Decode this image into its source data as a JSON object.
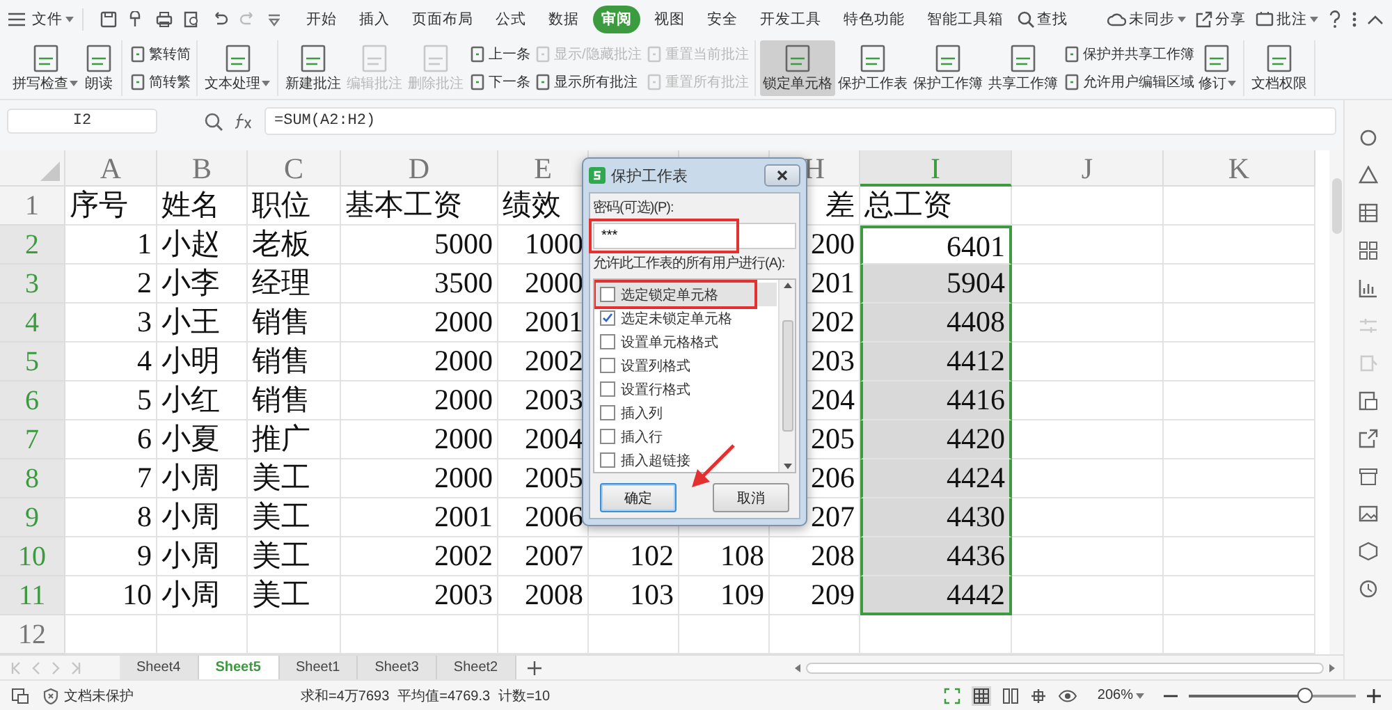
{
  "menu_bar": {
    "file_label": "文件",
    "tabs": [
      {
        "label": "开始",
        "selected": false
      },
      {
        "label": "插入",
        "selected": false
      },
      {
        "label": "页面布局",
        "selected": false
      },
      {
        "label": "公式",
        "selected": false
      },
      {
        "label": "数据",
        "selected": false
      },
      {
        "label": "审阅",
        "selected": true
      },
      {
        "label": "视图",
        "selected": false
      },
      {
        "label": "安全",
        "selected": false
      },
      {
        "label": "开发工具",
        "selected": false
      },
      {
        "label": "特色功能",
        "selected": false
      },
      {
        "label": "智能工具箱",
        "selected": false
      }
    ],
    "search_label": "查找",
    "sync_label": "未同步",
    "share_label": "分享",
    "comment_label": "批注"
  },
  "ribbon": {
    "groups": [
      {
        "items": [
          {
            "kind": "large",
            "label": "拼写检查",
            "dropdown": true,
            "disabled": false,
            "selected": false
          },
          {
            "kind": "large",
            "label": "朗读",
            "dropdown": false,
            "disabled": false,
            "selected": false
          }
        ]
      },
      {
        "items": [
          {
            "kind": "stack",
            "items": [
              {
                "label": "繁转简",
                "disabled": false
              },
              {
                "label": "简转繁",
                "disabled": false
              }
            ]
          }
        ]
      },
      {
        "items": [
          {
            "kind": "large",
            "label": "文本处理",
            "dropdown": true,
            "disabled": false,
            "selected": false
          }
        ]
      },
      {
        "items": [
          {
            "kind": "large",
            "label": "新建批注",
            "dropdown": false,
            "disabled": false,
            "selected": false
          },
          {
            "kind": "large",
            "label": "编辑批注",
            "dropdown": false,
            "disabled": true,
            "selected": false
          },
          {
            "kind": "large",
            "label": "删除批注",
            "dropdown": false,
            "disabled": true,
            "selected": false
          },
          {
            "kind": "stack",
            "items": [
              {
                "label": "上一条",
                "disabled": false
              },
              {
                "label": "下一条",
                "disabled": false
              }
            ]
          },
          {
            "kind": "stack",
            "items": [
              {
                "label": "显示/隐藏批注",
                "disabled": true
              },
              {
                "label": "显示所有批注",
                "disabled": false
              }
            ]
          },
          {
            "kind": "stack",
            "items": [
              {
                "label": "重置当前批注",
                "disabled": true
              },
              {
                "label": "重置所有批注",
                "disabled": true
              }
            ]
          }
        ]
      },
      {
        "items": [
          {
            "kind": "large",
            "label": "锁定单元格",
            "dropdown": false,
            "disabled": false,
            "selected": true
          },
          {
            "kind": "large",
            "label": "保护工作表",
            "dropdown": false,
            "disabled": false,
            "selected": false
          },
          {
            "kind": "large",
            "label": "保护工作簿",
            "dropdown": false,
            "disabled": false,
            "selected": false
          },
          {
            "kind": "large",
            "label": "共享工作簿",
            "dropdown": false,
            "disabled": false,
            "selected": false
          },
          {
            "kind": "stack",
            "items": [
              {
                "label": "保护并共享工作簿",
                "disabled": false
              },
              {
                "label": "允许用户编辑区域",
                "disabled": false
              }
            ]
          },
          {
            "kind": "large",
            "label": "修订",
            "dropdown": true,
            "disabled": false,
            "selected": false
          }
        ]
      },
      {
        "items": [
          {
            "kind": "large",
            "label": "文档权限",
            "dropdown": false,
            "disabled": false,
            "selected": false
          }
        ]
      }
    ]
  },
  "formula_bar": {
    "cell_name": "I2",
    "formula": "=SUM(A2:H2)"
  },
  "sheet": {
    "columns": [
      {
        "label": "A",
        "numeric": true,
        "selected": false
      },
      {
        "label": "B",
        "numeric": false,
        "selected": false
      },
      {
        "label": "C",
        "numeric": false,
        "selected": false
      },
      {
        "label": "D",
        "numeric": true,
        "selected": false
      },
      {
        "label": "E",
        "numeric": true,
        "selected": false
      },
      {
        "numeric": true,
        "selected": false
      },
      {
        "numeric": true,
        "selected": false
      },
      {
        "label": "H",
        "numeric": true,
        "selected": false
      },
      {
        "label": "I",
        "numeric": true,
        "selected": true
      },
      {
        "label": "J",
        "selected": false
      },
      {
        "label": "K",
        "selected": false
      }
    ],
    "rows": [
      {
        "label": "1",
        "kind": "header",
        "selected": false,
        "cells": [
          "序号",
          "姓名",
          "职位",
          "基本工资",
          "绩效",
          null,
          null,
          {
            "text": "差",
            "trailing": true
          },
          "总工资"
        ]
      },
      {
        "label": "2",
        "kind": "data",
        "selected": true,
        "active": true,
        "cells": [
          "1",
          "小赵",
          "老板",
          "5000",
          "1000",
          null,
          null,
          "200",
          "6401"
        ]
      },
      {
        "label": "3",
        "kind": "data",
        "selected": true,
        "cells": [
          "2",
          "小李",
          "经理",
          "3500",
          "2000",
          null,
          null,
          "201",
          "5904"
        ]
      },
      {
        "label": "4",
        "kind": "data",
        "selected": true,
        "cells": [
          "3",
          "小王",
          "销售",
          "2000",
          "2001",
          null,
          null,
          "202",
          "4408"
        ]
      },
      {
        "label": "5",
        "kind": "data",
        "selected": true,
        "cells": [
          "4",
          "小明",
          "销售",
          "2000",
          "2002",
          null,
          null,
          "203",
          "4412"
        ]
      },
      {
        "label": "6",
        "kind": "data",
        "selected": true,
        "cells": [
          "5",
          "小红",
          "销售",
          "2000",
          "2003",
          null,
          null,
          "204",
          "4416"
        ]
      },
      {
        "label": "7",
        "kind": "data",
        "selected": true,
        "cells": [
          "6",
          "小夏",
          "推广",
          "2000",
          "2004",
          null,
          null,
          "205",
          "4420"
        ]
      },
      {
        "label": "8",
        "kind": "data",
        "selected": true,
        "cells": [
          "7",
          "小周",
          "美工",
          "2000",
          "2005",
          null,
          null,
          "206",
          "4424"
        ]
      },
      {
        "label": "9",
        "kind": "data",
        "selected": true,
        "cells": [
          "8",
          "小周",
          "美工",
          "2001",
          "2006",
          null,
          null,
          "207",
          "4430"
        ]
      },
      {
        "label": "10",
        "kind": "data",
        "selected": true,
        "cells": [
          "9",
          "小周",
          "美工",
          "2002",
          "2007",
          "102",
          "108",
          "208",
          "4436"
        ]
      },
      {
        "label": "11",
        "kind": "data",
        "selected": true,
        "cells": [
          "10",
          "小周",
          "美工",
          "2003",
          "2008",
          "103",
          "109",
          "209",
          "4442"
        ]
      },
      {
        "label": "12",
        "kind": "data",
        "selected": false,
        "cells": []
      }
    ]
  },
  "dialog": {
    "title": "保护工作表",
    "password_label": "密码(可选)(P):",
    "password_value": "***",
    "permissions_label": "允许此工作表的所有用户进行(A):",
    "permissions": [
      {
        "label": "选定锁定单元格",
        "checked": false,
        "selected": true
      },
      {
        "label": "选定未锁定单元格",
        "checked": true,
        "selected": false
      },
      {
        "label": "设置单元格格式",
        "checked": false,
        "selected": false
      },
      {
        "label": "设置列格式",
        "checked": false,
        "selected": false
      },
      {
        "label": "设置行格式",
        "checked": false,
        "selected": false
      },
      {
        "label": "插入列",
        "checked": false,
        "selected": false
      },
      {
        "label": "插入行",
        "checked": false,
        "selected": false
      },
      {
        "label": "插入超链接",
        "checked": false,
        "selected": false
      }
    ],
    "buttons": [
      {
        "label": "确定",
        "focused": true
      },
      {
        "label": "取消",
        "focused": false
      }
    ],
    "annotations": {
      "password_box": true,
      "option_box": true,
      "arrow_to_ok": true
    }
  },
  "sheet_tabs": [
    {
      "label": "Sheet4",
      "selected": false
    },
    {
      "label": "Sheet5",
      "selected": true
    },
    {
      "label": "Sheet1",
      "selected": false
    },
    {
      "label": "Sheet3",
      "selected": false
    },
    {
      "label": "Sheet2",
      "selected": false
    }
  ],
  "status_bar": {
    "protection": "文档未保护",
    "sum": "求和=4万7693",
    "average": "平均值=4769.3",
    "count": "计数=10",
    "zoom": "206%",
    "zoom_slider": {
      "level": 0.69
    }
  }
}
